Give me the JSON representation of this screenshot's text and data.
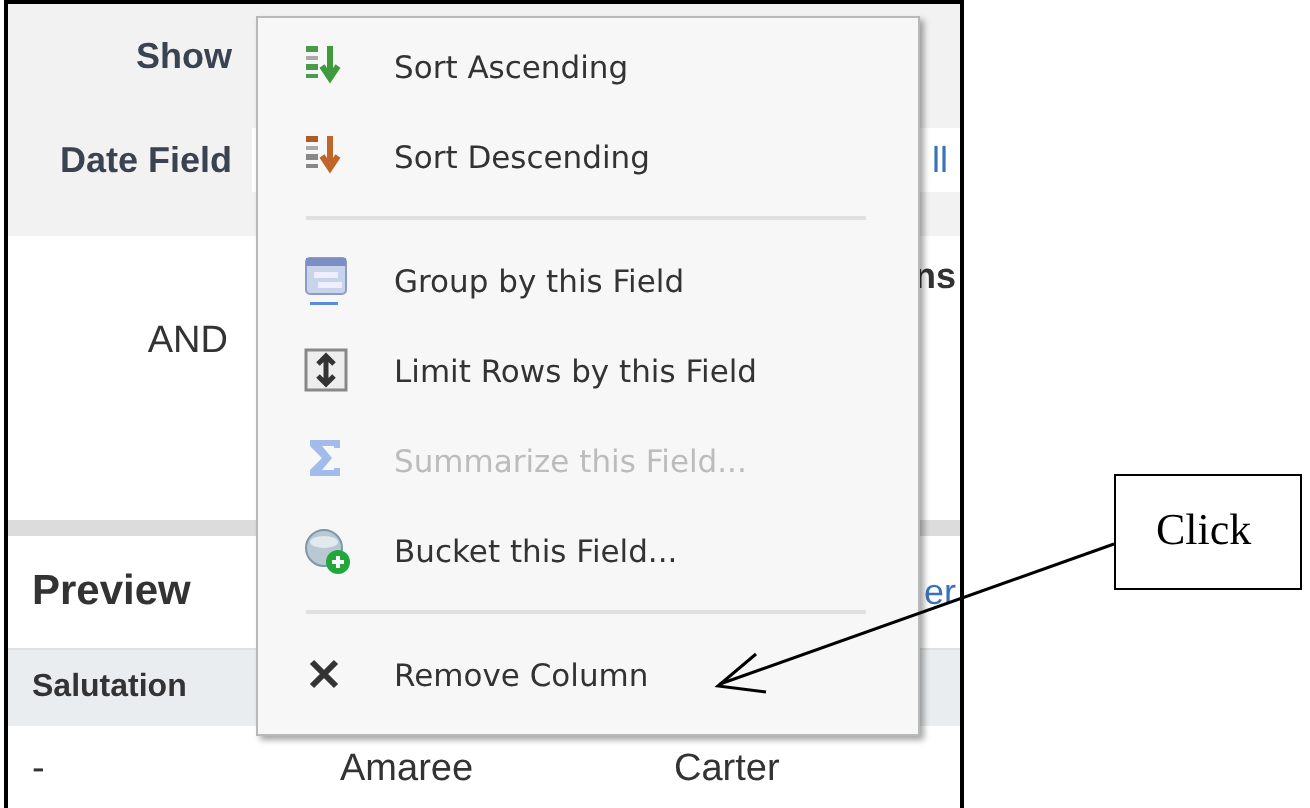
{
  "filters": [
    {
      "label": "Show"
    },
    {
      "label": "Date Field",
      "value": "ll"
    }
  ],
  "logic": {
    "operator": "AND",
    "heading": "ns"
  },
  "preview": {
    "title": "Preview",
    "link": "er",
    "columns": [
      "Salutation"
    ],
    "rows": [
      [
        "-",
        "Amaree",
        "Carter"
      ]
    ]
  },
  "menu": [
    {
      "kind": "item",
      "label": "Sort Ascending",
      "disabled": false
    },
    {
      "kind": "item",
      "label": "Sort Descending",
      "disabled": false
    },
    {
      "kind": "separator"
    },
    {
      "kind": "item",
      "label": "Group by this Field",
      "disabled": false
    },
    {
      "kind": "item",
      "label": "Limit Rows by this Field",
      "disabled": false
    },
    {
      "kind": "item",
      "label": "Summarize this Field...",
      "disabled": true
    },
    {
      "kind": "item",
      "label": "Bucket this Field...",
      "disabled": false
    },
    {
      "kind": "separator"
    },
    {
      "kind": "item",
      "label": "Remove Column",
      "disabled": false
    }
  ],
  "callout": {
    "text": "Click"
  }
}
